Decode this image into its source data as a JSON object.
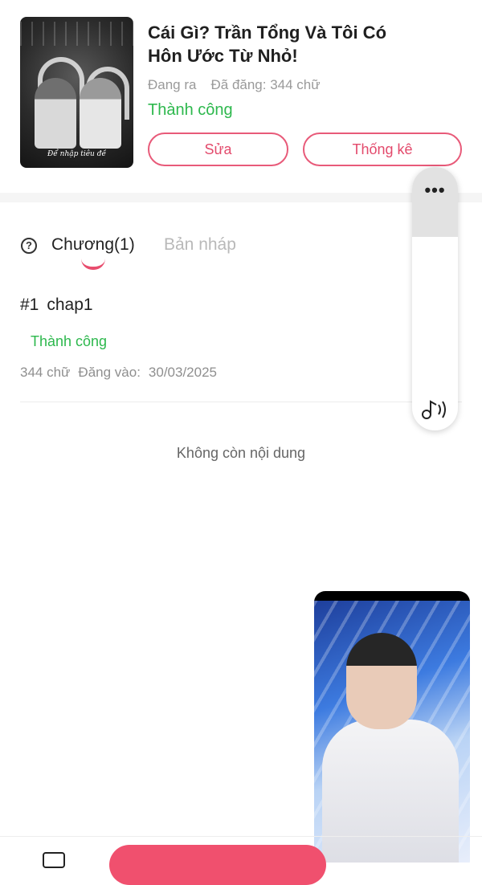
{
  "book": {
    "title": "Cái Gì? Trần Tổng Và Tôi Có Hôn Ước Từ Nhỏ!",
    "state": "Đang ra",
    "words_published": "Đã đăng: 344 chữ",
    "review_status": "Thành công",
    "cover_caption": "Để nhập tiêu đề"
  },
  "actions": {
    "edit_label": "Sửa",
    "stats_label": "Thống kê"
  },
  "tabs": {
    "chapters_label": "Chương(1)",
    "drafts_label": "Bản nháp"
  },
  "chapters": [
    {
      "number": "#1",
      "name": "chap1",
      "status": "Thành công",
      "words": "344 chữ",
      "posted_label": "Đăng vào:",
      "posted_date": "30/03/2025"
    }
  ],
  "empty_text": "Không còn nội dung",
  "colors": {
    "accent": "#e84d6e",
    "success": "#2db84d"
  },
  "icons": {
    "help": "question-circle-icon",
    "more": "more-dots-icon",
    "music": "music-note-icon"
  }
}
